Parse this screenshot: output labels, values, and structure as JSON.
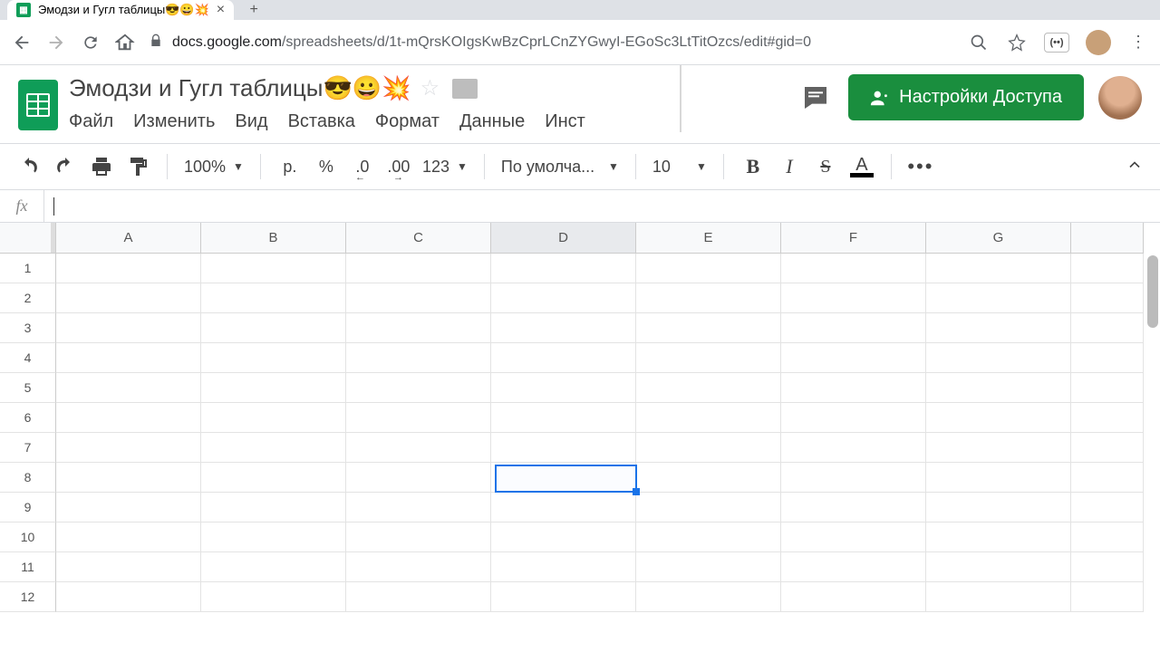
{
  "tab": {
    "title": "Эмодзи и Гугл таблицы😎😀💥"
  },
  "url": {
    "domain": "docs.google.com",
    "path": "/spreadsheets/d/1t-mQrsKOIgsKwBzCprLCnZYGwyI-EGoSc3LtTitOzcs/edit#gid=0"
  },
  "doc": {
    "title": "Эмодзи и Гугл таблицы😎😀💥"
  },
  "menu": [
    "Файл",
    "Изменить",
    "Вид",
    "Вставка",
    "Формат",
    "Данные",
    "Инст"
  ],
  "share": {
    "label": "Настройки Доступа"
  },
  "toolbar": {
    "zoom": "100%",
    "currency": "р.",
    "percent": "%",
    "dec_dec": ".0",
    "inc_dec": ".00",
    "num_fmt": "123",
    "font": "По умолча...",
    "size": "10",
    "more": "•••"
  },
  "formula": {
    "label": "fx"
  },
  "columns": [
    "A",
    "B",
    "C",
    "D",
    "E",
    "F",
    "G"
  ],
  "rows": [
    "1",
    "2",
    "3",
    "4",
    "5",
    "6",
    "7",
    "8",
    "9",
    "10",
    "11",
    "12"
  ],
  "active_col_index": 3,
  "selection": {
    "row": 8,
    "col": "D"
  },
  "ext_label": "(••)"
}
